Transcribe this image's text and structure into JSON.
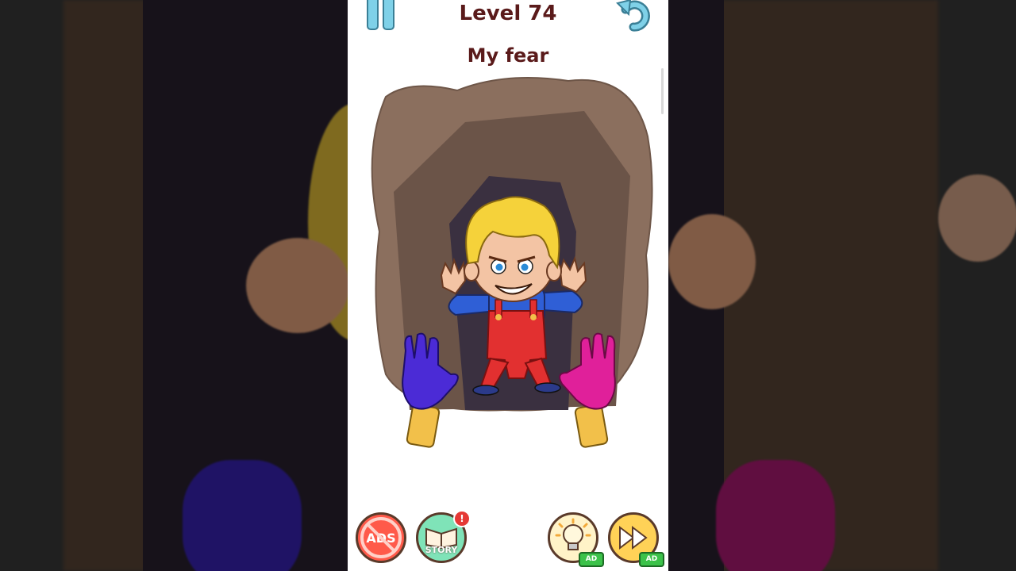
{
  "header": {
    "level_label": "Level 74",
    "pause_icon": "pause-icon",
    "undo_icon": "undo-icon"
  },
  "puzzle": {
    "prompt": "My fear"
  },
  "bottom_bar": {
    "no_ads_label": "ADS",
    "story_label": "STORY",
    "story_badge": "!",
    "hint_ad_tag": "AD",
    "skip_ad_tag": "AD"
  },
  "colors": {
    "title": "#5a1a1a",
    "cave_outer": "#8b6f5e",
    "cave_inner": "#6b5448",
    "tunnel": "#3a3040",
    "blue_hand": "#4b2bd6",
    "pink_hand": "#e0209a",
    "gold_wrist": "#f2c04a"
  }
}
